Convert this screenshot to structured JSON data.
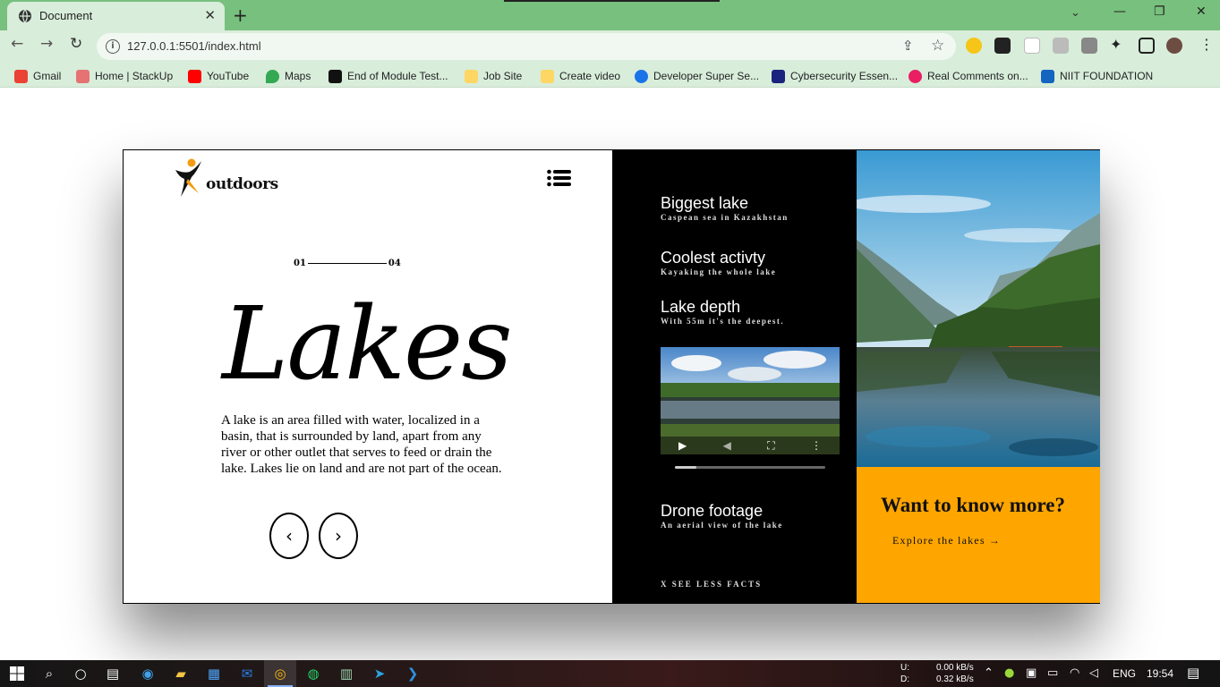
{
  "browser": {
    "tab": {
      "title": "Document",
      "close_glyph": "✕"
    },
    "new_tab_glyph": "+",
    "url": "127.0.0.1:5501/index.html",
    "window_controls": {
      "tab_list": "⌄",
      "minimize": "—",
      "restore": "❐",
      "close": "✕"
    },
    "nav": {
      "back": "←",
      "forward": "→",
      "reload": "↻"
    },
    "bookmarks": [
      {
        "label": "Gmail",
        "icon": "gmail-icon",
        "color": "#ea4335"
      },
      {
        "label": "Home | StackUp",
        "icon": "stackup-icon",
        "color": "#e57373"
      },
      {
        "label": "YouTube",
        "icon": "youtube-icon",
        "color": "#ff0000"
      },
      {
        "label": "Maps",
        "icon": "maps-icon",
        "color": "#34a853"
      },
      {
        "label": "End of Module Test...",
        "icon": "gc-icon",
        "color": "#111111"
      },
      {
        "label": "Job Site",
        "icon": "folder-icon",
        "color": "#fdd663"
      },
      {
        "label": "Create video",
        "icon": "folder-icon",
        "color": "#fdd663"
      },
      {
        "label": "Developer Super Se...",
        "icon": "developer-icon",
        "color": "#1a73e8"
      },
      {
        "label": "Cybersecurity Essen...",
        "icon": "cisco-icon",
        "color": "#1a237e"
      },
      {
        "label": "Real Comments on...",
        "icon": "comments-icon",
        "color": "#e91e63"
      },
      {
        "label": "NIIT FOUNDATION",
        "icon": "niit-icon",
        "color": "#1565c0"
      }
    ]
  },
  "page": {
    "logo_text": "outdoors",
    "counter": {
      "start": "01",
      "end": "04"
    },
    "hero_title": "Lakes",
    "description": "A lake is an area filled with water, localized in a basin, that is surrounded by land, apart from any river or other outlet that serves to feed or drain the lake. Lakes lie on land and are not part of the ocean.",
    "prev_glyph": "‹",
    "next_glyph": "›",
    "facts": [
      {
        "title": "Biggest lake",
        "subtitle": "Caspean sea in Kazakhstan"
      },
      {
        "title": "Coolest activty",
        "subtitle": "Kayaking the whole lake"
      },
      {
        "title": "Lake depth",
        "subtitle": "With 55m it's the deepest."
      }
    ],
    "video": {
      "progress": 0.14
    },
    "drone": {
      "title": "Drone footage",
      "subtitle": "An aerial view of the lake"
    },
    "see_less": "X SEE LESS FACTS",
    "info": {
      "title": "Want to know more?",
      "link": "Explore the lakes →"
    },
    "colors": {
      "accent": "#ffa500",
      "dark_panel": "#000000"
    }
  },
  "taskbar": {
    "net_up_label": "U:",
    "net_down_label": "D:",
    "net_up": "0.00 kB/s",
    "net_down": "0.32 kB/s",
    "language": "ENG",
    "time": "19:54"
  }
}
